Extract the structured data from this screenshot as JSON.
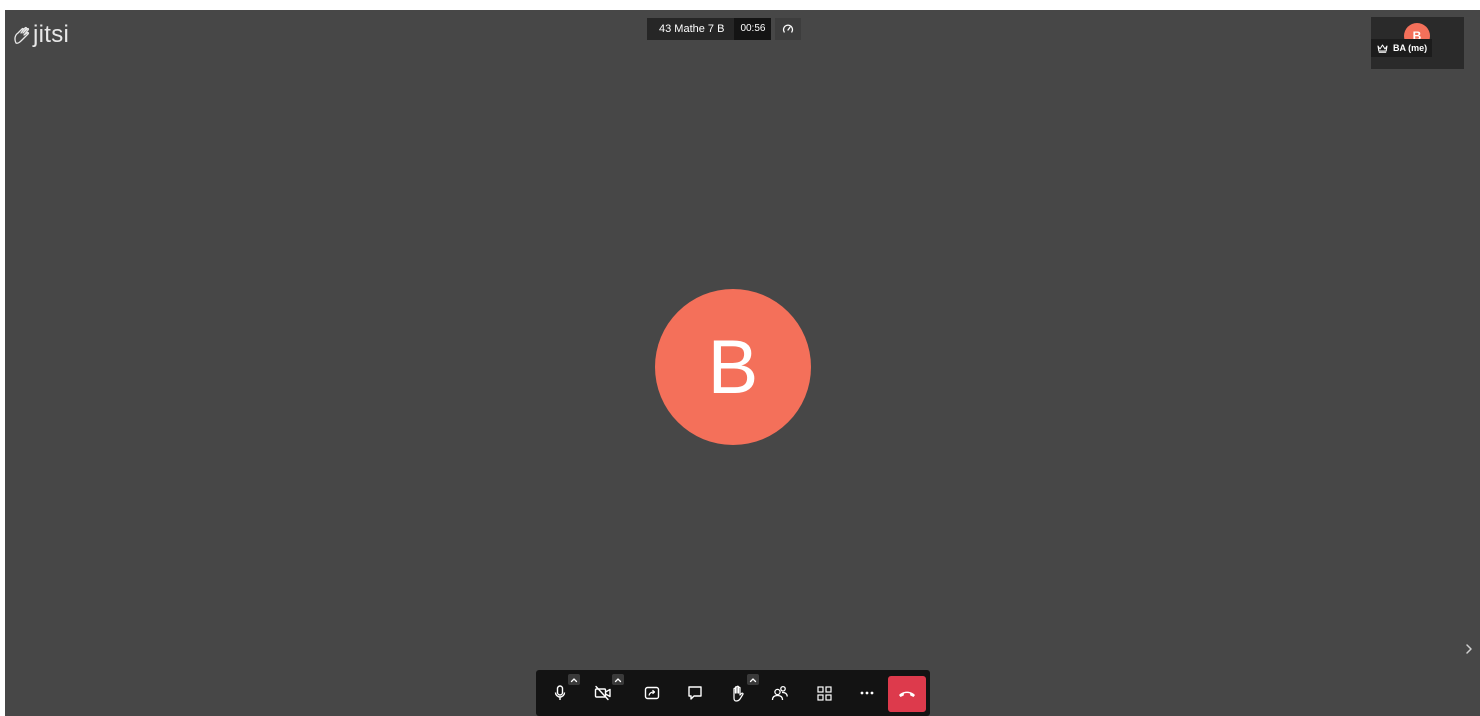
{
  "app": {
    "logo_text": "jitsi"
  },
  "meeting": {
    "subject": "43 Mathe 7 B",
    "timer": "00:56"
  },
  "main_participant": {
    "avatar_initial": "B"
  },
  "local_thumbnail": {
    "avatar_initial": "B",
    "display_name": "BA (me)",
    "moderator_icon": "crown-icon"
  },
  "toolbar": {
    "buttons": [
      {
        "icon": "microphone-icon"
      },
      {
        "icon": "camera-off-icon"
      },
      {
        "icon": "screen-share-icon"
      },
      {
        "icon": "chat-icon"
      },
      {
        "icon": "raise-hand-icon"
      },
      {
        "icon": "participants-icon"
      },
      {
        "icon": "tile-view-icon"
      },
      {
        "icon": "more-actions-icon"
      },
      {
        "icon": "hangup-icon"
      }
    ]
  },
  "colors": {
    "stage_bg": "#474747",
    "avatar": "#f4705a",
    "hangup": "#dd3a4c",
    "toolbar_bg": "#131313"
  }
}
